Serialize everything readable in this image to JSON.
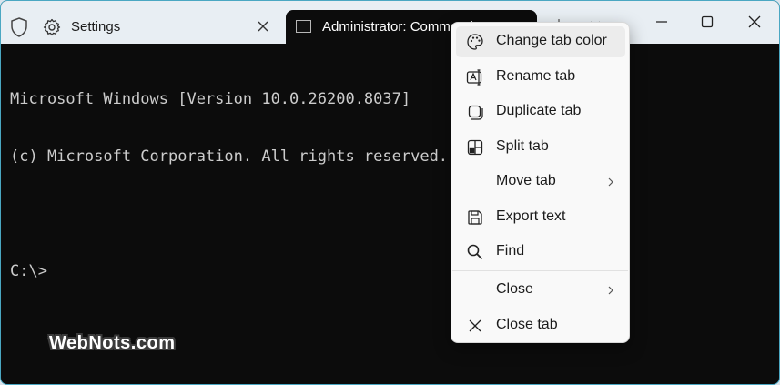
{
  "tabs": {
    "settings": {
      "label": "Settings"
    },
    "admin": {
      "label": "Administrator: Command Prompt"
    }
  },
  "terminal": {
    "lines": [
      "Microsoft Windows [Version 10.0.26200.8037]",
      "(c) Microsoft Corporation. All rights reserved.",
      "",
      "C:\\>"
    ]
  },
  "context_menu": {
    "items": [
      {
        "label": "Change tab color",
        "icon": "palette-icon",
        "submenu": false
      },
      {
        "label": "Rename tab",
        "icon": "rename-icon",
        "submenu": false
      },
      {
        "label": "Duplicate tab",
        "icon": "duplicate-icon",
        "submenu": false
      },
      {
        "label": "Split tab",
        "icon": "split-icon",
        "submenu": false
      },
      {
        "label": "Move tab",
        "icon": "",
        "submenu": true
      },
      {
        "label": "Export text",
        "icon": "save-icon",
        "submenu": false
      },
      {
        "label": "Find",
        "icon": "search-icon",
        "submenu": false
      },
      {
        "label": "Close",
        "icon": "",
        "submenu": true
      },
      {
        "label": "Close tab",
        "icon": "close-icon",
        "submenu": false
      }
    ]
  },
  "watermark": {
    "text": "WebNots.com"
  },
  "colors": {
    "terminal_bg": "#0c0c0c",
    "titlebar_bg": "#e8eef3",
    "menu_bg": "#f9f9f9",
    "window_border": "#4aa7c2"
  }
}
